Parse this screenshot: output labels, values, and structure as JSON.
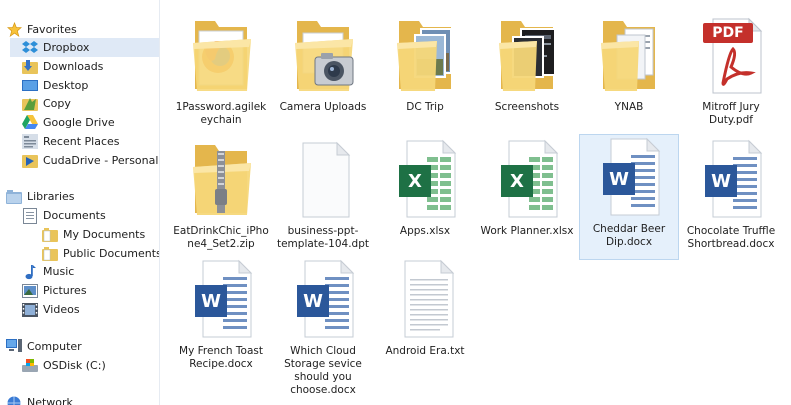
{
  "nav": {
    "items": [
      {
        "label": "Favorites",
        "icon": "star-icon"
      },
      {
        "label": "Dropbox",
        "icon": "dropbox-icon"
      },
      {
        "label": "Downloads",
        "icon": "downloads-folder-icon"
      },
      {
        "label": "Desktop",
        "icon": "desktop-icon"
      },
      {
        "label": "Copy",
        "icon": "copy-app-icon"
      },
      {
        "label": "Google Drive",
        "icon": "google-drive-icon"
      },
      {
        "label": "Recent Places",
        "icon": "recent-places-icon"
      },
      {
        "label": "CudaDrive - Personal I",
        "icon": "cudadrive-icon"
      },
      {
        "label": "Libraries",
        "icon": "libraries-icon"
      },
      {
        "label": "Documents",
        "icon": "documents-icon"
      },
      {
        "label": "My Documents",
        "icon": "folder-icon"
      },
      {
        "label": "Public Documents",
        "icon": "folder-icon"
      },
      {
        "label": "Music",
        "icon": "music-icon"
      },
      {
        "label": "Pictures",
        "icon": "pictures-icon"
      },
      {
        "label": "Videos",
        "icon": "videos-icon"
      },
      {
        "label": "Computer",
        "icon": "computer-icon"
      },
      {
        "label": "OSDisk (C:)",
        "icon": "disk-icon"
      },
      {
        "label": "Network",
        "icon": "network-icon"
      }
    ]
  },
  "files": [
    {
      "name": "1Password.agilekeychain",
      "type": "folder-firefox"
    },
    {
      "name": "Camera Uploads",
      "type": "folder-camera"
    },
    {
      "name": "DC Trip",
      "type": "folder-photos"
    },
    {
      "name": "Screenshots",
      "type": "folder-screens"
    },
    {
      "name": "YNAB",
      "type": "folder-docs"
    },
    {
      "name": "Mitroff Jury Duty.pdf",
      "type": "pdf",
      "badge": "PDF"
    },
    {
      "name": "EatDrinkChic_iPhone4_Set2.zip",
      "type": "zip"
    },
    {
      "name": "business-ppt-template-104.dpt",
      "type": "blank"
    },
    {
      "name": "Apps.xlsx",
      "type": "excel",
      "badge": "X"
    },
    {
      "name": "Work Planner.xlsx",
      "type": "excel",
      "badge": "X"
    },
    {
      "name": "Cheddar Beer Dip.docx",
      "type": "word",
      "badge": "W",
      "selected": true
    },
    {
      "name": "Chocolate Truffle Shortbread.docx",
      "type": "word",
      "badge": "W"
    },
    {
      "name": "My French Toast Recipe.docx",
      "type": "word",
      "badge": "W"
    },
    {
      "name": "Which Cloud Storage sevice should you choose.docx",
      "type": "word",
      "badge": "W"
    },
    {
      "name": "Android Era.txt",
      "type": "txt"
    }
  ],
  "colors": {
    "excel": "#1e7145",
    "word": "#2b579a",
    "pdf": "#c4302b",
    "folder": "#f5d479",
    "folder_dark": "#e2b84a",
    "selection": "#e5f0fb"
  }
}
